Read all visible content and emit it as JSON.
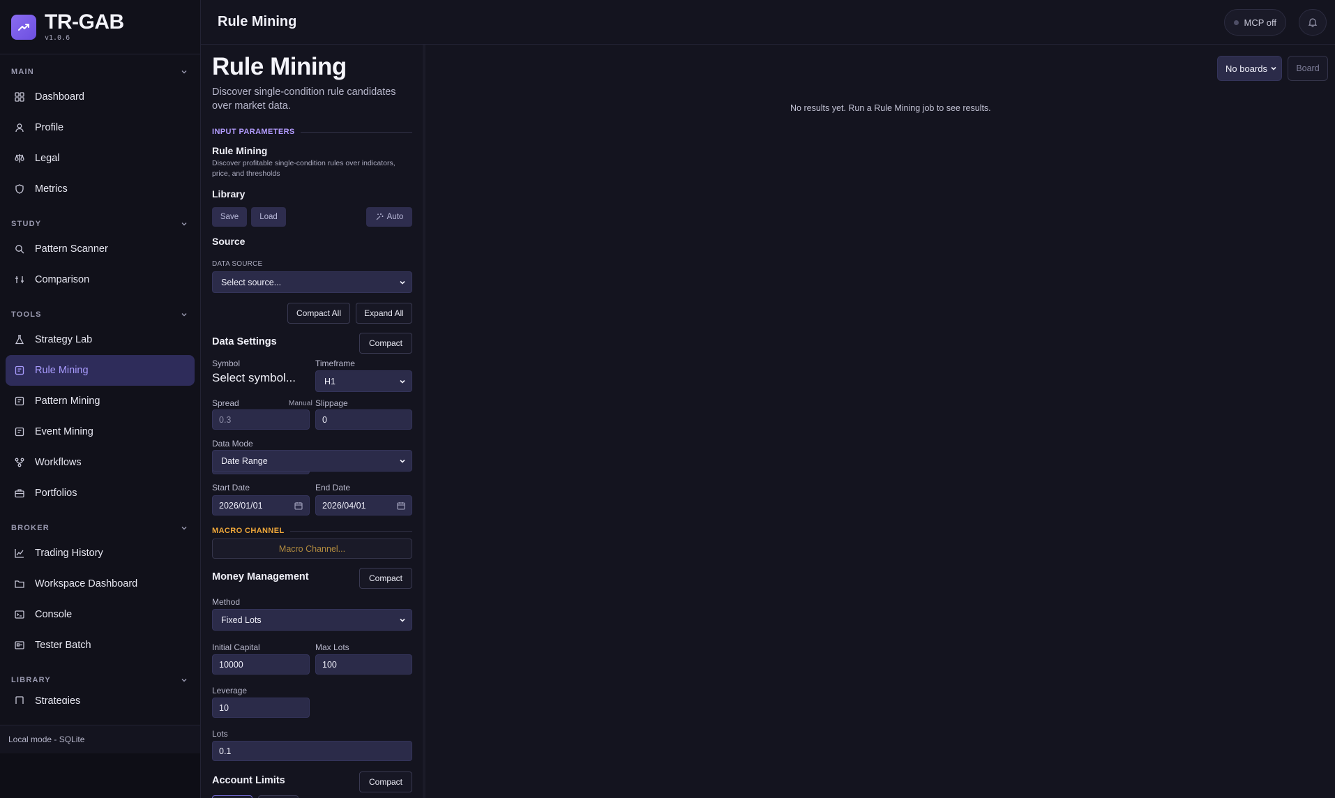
{
  "app": {
    "name": "TR-GAB",
    "version": "v1.0.6"
  },
  "sidebar": {
    "sections": [
      {
        "title": "MAIN",
        "items": [
          "Dashboard",
          "Profile",
          "Legal",
          "Metrics"
        ]
      },
      {
        "title": "STUDY",
        "items": [
          "Pattern Scanner",
          "Comparison"
        ]
      },
      {
        "title": "TOOLS",
        "items": [
          "Strategy Lab",
          "Rule Mining",
          "Pattern Mining",
          "Event Mining",
          "Workflows",
          "Portfolios"
        ]
      },
      {
        "title": "BROKER",
        "items": [
          "Trading History",
          "Workspace Dashboard",
          "Console",
          "Tester Batch"
        ]
      },
      {
        "title": "LIBRARY",
        "items": [
          "Strategies"
        ]
      }
    ],
    "active_item": "Rule Mining",
    "footer": "Local mode - SQLite"
  },
  "header": {
    "title": "Rule Mining",
    "mcp_label": "MCP off"
  },
  "panel": {
    "title": "Rule Mining",
    "subtitle": "Discover single-condition rule candidates over market data.",
    "input_params_label": "INPUT PARAMETERS",
    "tool_name": "Rule Mining",
    "tool_desc": "Discover profitable single-condition rules over indicators, price, and thresholds",
    "library": {
      "title": "Library",
      "save": "Save",
      "load": "Load",
      "auto": "Auto"
    },
    "source": {
      "title": "Source",
      "data_source_label": "DATA SOURCE",
      "data_source_value": "Select source..."
    },
    "compact_all": "Compact All",
    "expand_all": "Expand All",
    "data_settings": {
      "title": "Data Settings",
      "compact": "Compact",
      "symbol_label": "Symbol",
      "symbol_value": "Select symbol...",
      "timeframe_label": "Timeframe",
      "timeframe_value": "H1",
      "spread_label": "Spread",
      "spread_mode": "Manual",
      "spread_value": "0.3",
      "slippage_label": "Slippage",
      "slippage_value": "0",
      "data_mode_label": "Data Mode",
      "data_mode_value": "Date Range",
      "start_date_label": "Start Date",
      "start_date_value": "2026/01/01",
      "end_date_label": "End Date",
      "end_date_value": "2026/04/01"
    },
    "macro": {
      "label": "MACRO CHANNEL",
      "button": "Macro Channel..."
    },
    "money_management": {
      "title": "Money Management",
      "compact": "Compact",
      "method_label": "Method",
      "method_value": "Fixed Lots",
      "initial_capital_label": "Initial Capital",
      "initial_capital_value": "10000",
      "max_lots_label": "Max Lots",
      "max_lots_value": "100",
      "leverage_label": "Leverage",
      "leverage_value": "10",
      "lots_label": "Lots",
      "lots_value": "0.1"
    },
    "account_limits": {
      "title": "Account Limits",
      "compact": "Compact"
    }
  },
  "results": {
    "boards_select": "No boards",
    "board_button": "Board",
    "empty_message": "No results yet. Run a Rule Mining job to see results."
  },
  "colors": {
    "accent": "#a99cff",
    "active_bg": "#2e2c5a",
    "macro": "#f0a83a",
    "background": "#14141f"
  }
}
